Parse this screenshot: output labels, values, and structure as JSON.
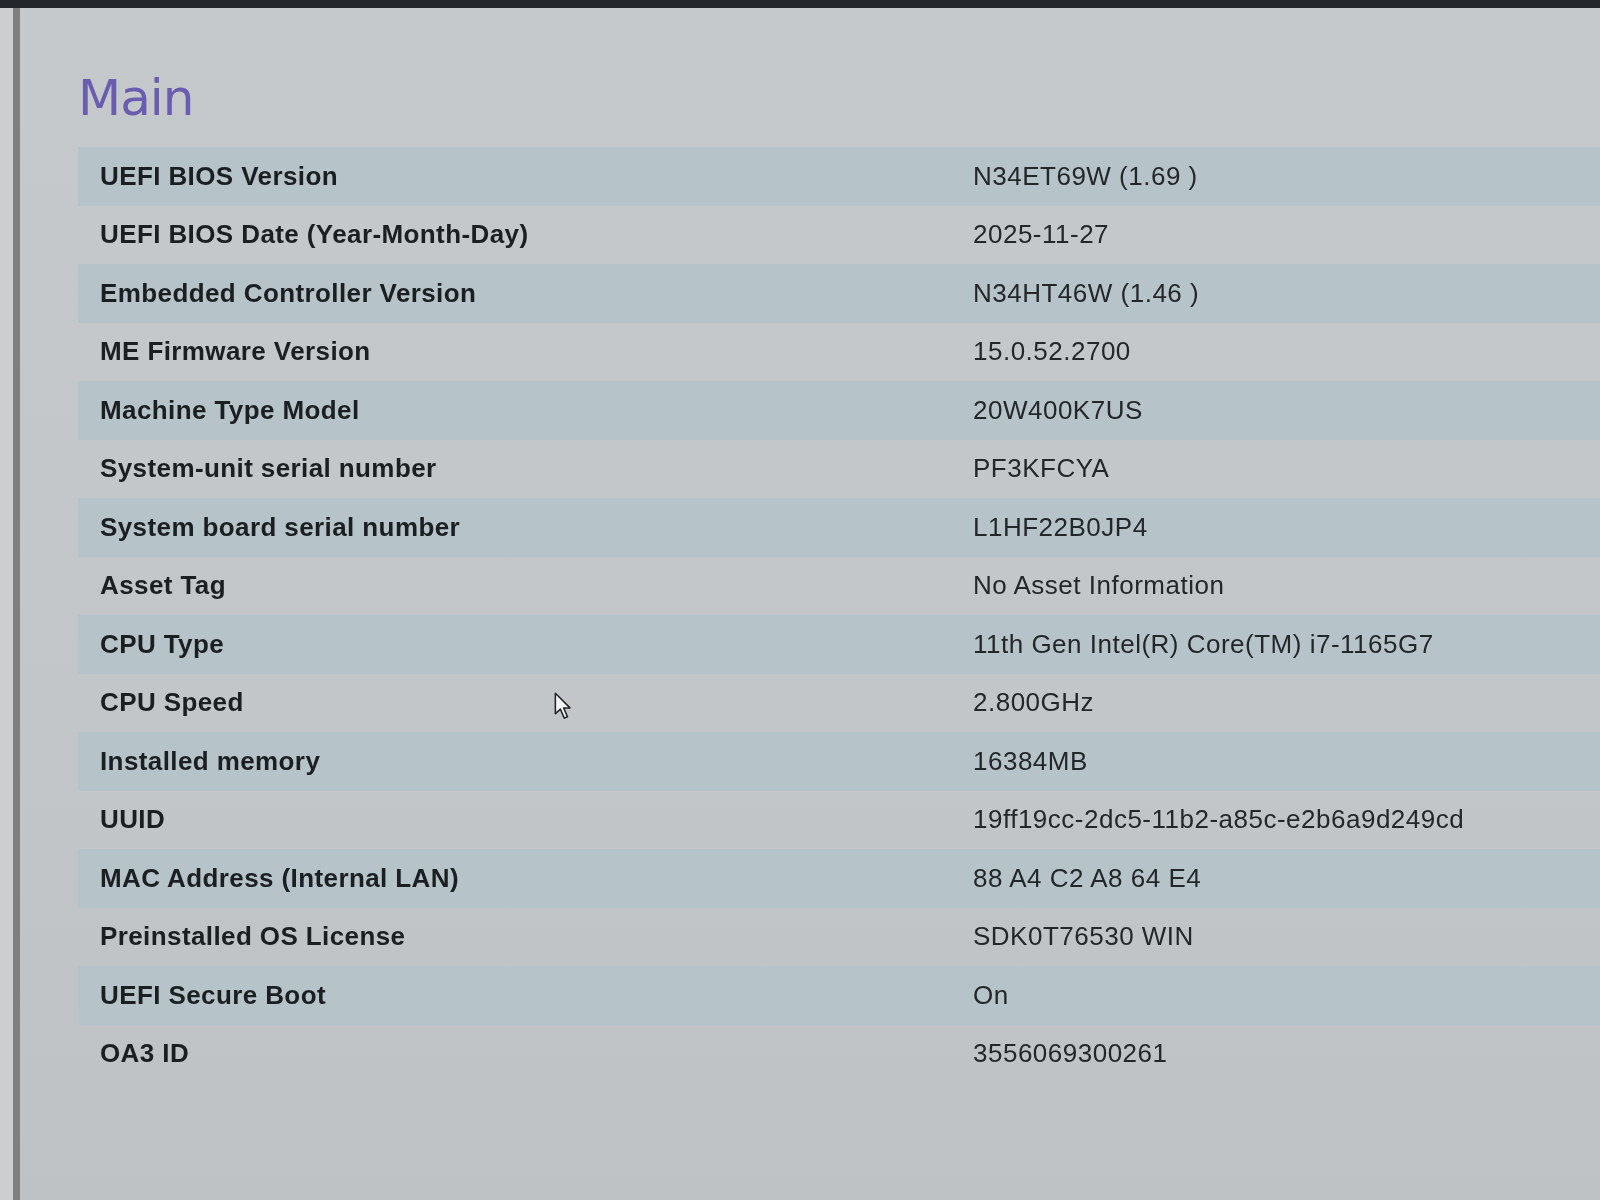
{
  "title": "Main",
  "rows": [
    {
      "label": "UEFI BIOS Version",
      "value": "N34ET69W (1.69 )"
    },
    {
      "label": "UEFI BIOS Date (Year-Month-Day)",
      "value": "2025-11-27"
    },
    {
      "label": "Embedded Controller Version",
      "value": "N34HT46W (1.46 )"
    },
    {
      "label": "ME Firmware Version",
      "value": "15.0.52.2700"
    },
    {
      "label": "Machine Type Model",
      "value": "20W400K7US"
    },
    {
      "label": "System-unit serial number",
      "value": "PF3KFCYA"
    },
    {
      "label": "System board serial number",
      "value": "L1HF22B0JP4"
    },
    {
      "label": "Asset Tag",
      "value": "No Asset Information"
    },
    {
      "label": "CPU Type",
      "value": "11th Gen Intel(R) Core(TM) i7-1165G7"
    },
    {
      "label": "CPU Speed",
      "value": "2.800GHz"
    },
    {
      "label": "Installed memory",
      "value": "16384MB"
    },
    {
      "label": "UUID",
      "value": "19ff19cc-2dc5-11b2-a85c-e2b6a9d249cd"
    },
    {
      "label": "MAC Address (Internal LAN)",
      "value": "88 A4 C2 A8 64 E4"
    },
    {
      "label": "Preinstalled OS License",
      "value": "SDK0T76530 WIN"
    },
    {
      "label": "UEFI Secure Boot",
      "value": "On"
    },
    {
      "label": "OA3 ID",
      "value": "3556069300261"
    }
  ]
}
